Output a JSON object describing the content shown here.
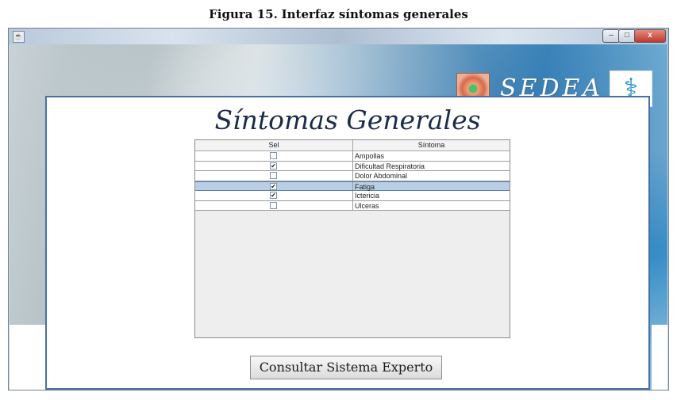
{
  "caption": {
    "figure": "Figura 15.",
    "title": "Interfaz síntomas generales"
  },
  "window": {
    "app_icon": "java-cup-icon",
    "controls": {
      "minimize": "–",
      "maximize": "□",
      "close": "x"
    }
  },
  "banner": {
    "brand": "SEDEA",
    "logo_icon": "cell-image-icon",
    "emblem_icon": "caduceus-icon"
  },
  "page": {
    "title": "Síntomas Generales"
  },
  "table": {
    "columns": [
      "Sel",
      "Síntoma"
    ],
    "rows": [
      {
        "checked": "",
        "symptom": "Ampollas"
      },
      {
        "checked": "✔",
        "symptom": "Dificultad Respiratoria"
      },
      {
        "checked": "",
        "symptom": "Dolor Abdominal"
      },
      {
        "checked": "✔",
        "symptom": "Fatiga",
        "selected": true
      },
      {
        "checked": "✔",
        "symptom": "Ictericia"
      },
      {
        "checked": "",
        "symptom": "Ulceras"
      }
    ]
  },
  "actions": {
    "consult_label": "Consultar Sistema Experto"
  },
  "colors": {
    "panel_border": "#4a6fa5",
    "selected_row": "#b8cfe5",
    "title_text": "#1d2b4a"
  }
}
